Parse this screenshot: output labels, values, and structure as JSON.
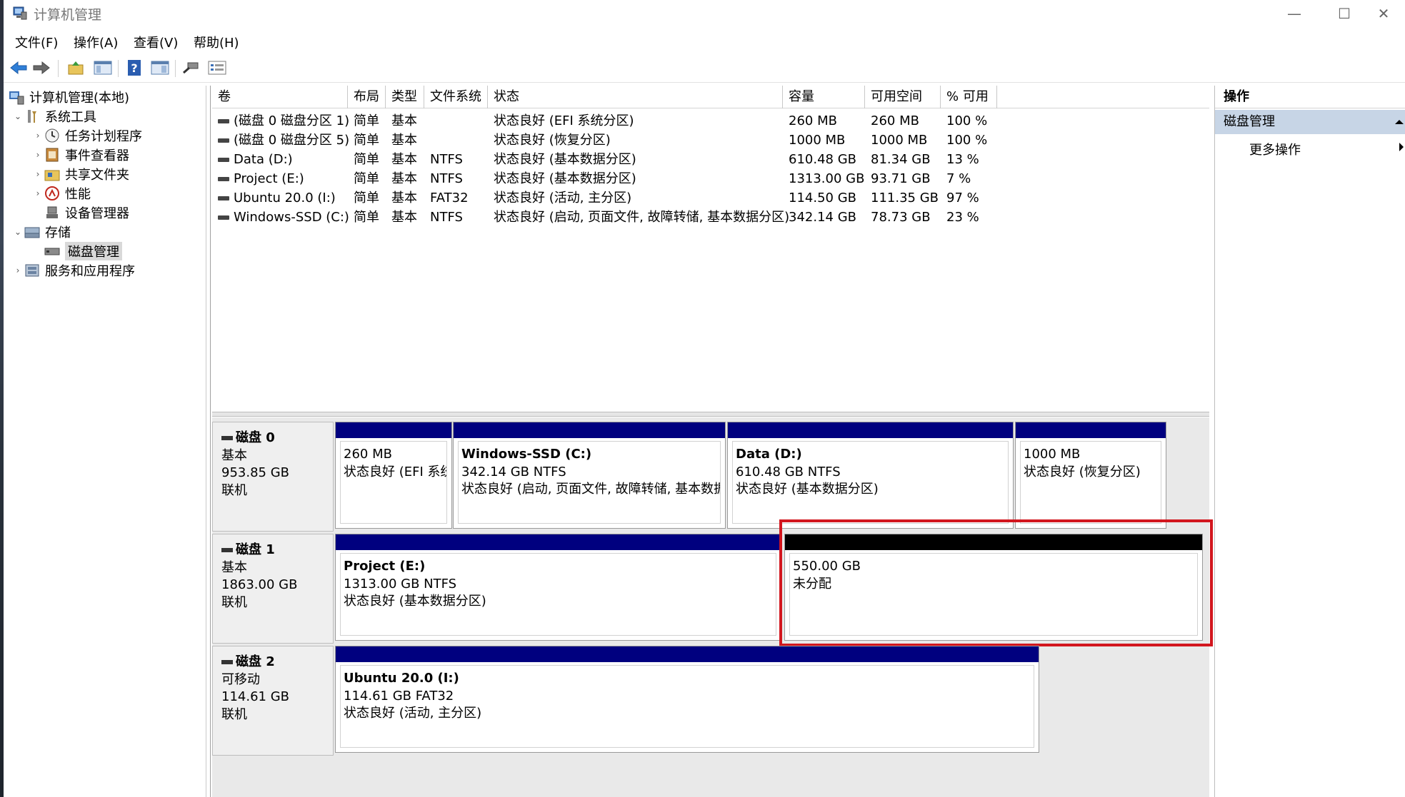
{
  "window": {
    "title": "计算机管理",
    "minimize": "—",
    "maximize": "☐",
    "close": "✕"
  },
  "menu": [
    "文件(F)",
    "操作(A)",
    "查看(V)",
    "帮助(H)"
  ],
  "toolbar": [
    "back-icon",
    "forward-icon",
    "up-folder-icon",
    "show-hide-tree-icon",
    "help-icon",
    "properties-icon",
    "connect-icon",
    "list-icon"
  ],
  "tree": {
    "root": "计算机管理(本地)",
    "system_tools": "系统工具",
    "task_scheduler": "任务计划程序",
    "event_viewer": "事件查看器",
    "shared_folders": "共享文件夹",
    "performance": "性能",
    "device_manager": "设备管理器",
    "storage": "存储",
    "disk_management": "磁盘管理",
    "services": "服务和应用程序"
  },
  "volume_table": {
    "columns": [
      "卷",
      "布局",
      "类型",
      "文件系统",
      "状态",
      "容量",
      "可用空间",
      "% 可用"
    ],
    "rows": [
      [
        "(磁盘 0 磁盘分区 1)",
        "简单",
        "基本",
        "",
        "状态良好 (EFI 系统分区)",
        "260 MB",
        "260 MB",
        "100 %"
      ],
      [
        "(磁盘 0 磁盘分区 5)",
        "简单",
        "基本",
        "",
        "状态良好 (恢复分区)",
        "1000 MB",
        "1000 MB",
        "100 %"
      ],
      [
        "Data (D:)",
        "简单",
        "基本",
        "NTFS",
        "状态良好 (基本数据分区)",
        "610.48 GB",
        "81.34 GB",
        "13 %"
      ],
      [
        "Project (E:)",
        "简单",
        "基本",
        "NTFS",
        "状态良好 (基本数据分区)",
        "1313.00 GB",
        "93.71 GB",
        "7 %"
      ],
      [
        "Ubuntu 20.0 (I:)",
        "简单",
        "基本",
        "FAT32",
        "状态良好 (活动, 主分区)",
        "114.50 GB",
        "111.35 GB",
        "97 %"
      ],
      [
        "Windows-SSD (C:)",
        "简单",
        "基本",
        "NTFS",
        "状态良好 (启动, 页面文件, 故障转储, 基本数据分区)",
        "342.14 GB",
        "78.73 GB",
        "23 %"
      ]
    ]
  },
  "disks": [
    {
      "name": "磁盘 0",
      "type": "基本",
      "size": "953.85 GB",
      "status": "联机",
      "partitions": [
        {
          "name": "",
          "line1": "260 MB",
          "line2": "状态良好 (EFI 系统"
        },
        {
          "name": "Windows-SSD  (C:)",
          "line1": "342.14 GB NTFS",
          "line2": "状态良好 (启动, 页面文件, 故障转储, 基本数据"
        },
        {
          "name": "Data  (D:)",
          "line1": "610.48 GB NTFS",
          "line2": "状态良好 (基本数据分区)"
        },
        {
          "name": "",
          "line1": "1000 MB",
          "line2": "状态良好 (恢复分区)"
        }
      ]
    },
    {
      "name": "磁盘 1",
      "type": "基本",
      "size": "1863.00 GB",
      "status": "联机",
      "partitions": [
        {
          "name": "Project  (E:)",
          "line1": "1313.00 GB NTFS",
          "line2": "状态良好 (基本数据分区)"
        },
        {
          "name": "",
          "line1": "550.00 GB",
          "line2": "未分配"
        }
      ]
    },
    {
      "name": "磁盘 2",
      "type": "可移动",
      "size": "114.61 GB",
      "status": "联机",
      "partitions": [
        {
          "name": "Ubuntu 20.0  (I:)",
          "line1": "114.61 GB FAT32",
          "line2": "状态良好 (活动, 主分区)"
        }
      ]
    }
  ],
  "actions": {
    "header": "操作",
    "section": "磁盘管理",
    "more": "更多操作"
  },
  "colors": {
    "partition_bar": "#00007f",
    "unallocated_bar": "#000000",
    "highlight": "#d2161e",
    "actions_section_bg": "#c7d5e6"
  }
}
